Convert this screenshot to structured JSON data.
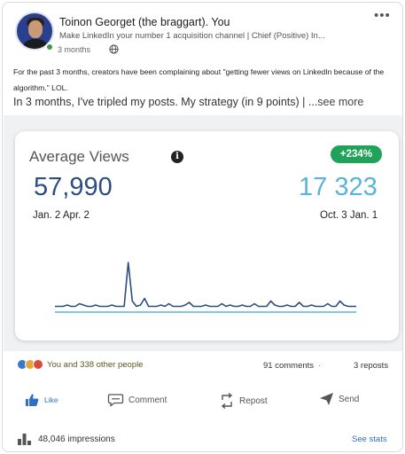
{
  "post": {
    "author_name": "Toinon Georget (the braggart). You",
    "author_headline": "Make LinkedIn your number 1 acquisition channel | Chief (Positive) In...",
    "time_ago": "3 months",
    "visibility_icon": "globe-icon",
    "more_label": "•••",
    "body_line1": "For the past 3 months, creators have been complaining about \"getting fewer views on LinkedIn because of the algorithm.\" LOL.",
    "body_line2": "In 3 months, I've tripled my posts. My strategy (in 9 points) | ...",
    "see_more": "see more"
  },
  "chart_card": {
    "title": "Average Views",
    "info_icon_label": "i",
    "growth_badge": "+234%",
    "left_value": "57,990",
    "right_value": "17 323",
    "left_range": "Jan. 2 Apr. 2",
    "right_range": "Oct. 3 Jan. 1",
    "colors": {
      "left_value": "#2d4e82",
      "right_value": "#5cb3da",
      "badge": "#20a259",
      "line": "#2d4e82"
    }
  },
  "chart_data": {
    "type": "line",
    "series": [
      {
        "values": [
          5,
          5,
          5,
          6,
          5,
          5,
          7,
          6,
          5,
          5,
          6,
          5,
          5,
          5,
          6,
          5,
          5,
          5,
          38,
          9,
          5,
          6,
          11,
          5,
          5,
          5,
          6,
          5,
          7,
          5,
          5,
          5,
          6,
          8,
          5,
          5,
          5,
          6,
          5,
          5,
          5,
          7,
          5,
          6,
          5,
          5,
          6,
          5,
          5,
          7,
          5,
          5,
          5,
          9,
          6,
          5,
          5,
          6,
          5,
          5,
          8,
          5,
          5,
          6,
          5,
          5,
          5,
          7,
          5,
          5,
          9,
          6,
          5,
          5,
          5
        ]
      }
    ]
  },
  "social": {
    "reactions_text": "You and 338 other people",
    "comments": "91 comments",
    "separator": "·",
    "reposts": "3 reposts"
  },
  "actions": {
    "like": "Like",
    "comment": "Comment",
    "repost": "Repost",
    "send": "Send"
  },
  "footer": {
    "impressions": "48,046 impressions",
    "see_stats": "See stats"
  }
}
